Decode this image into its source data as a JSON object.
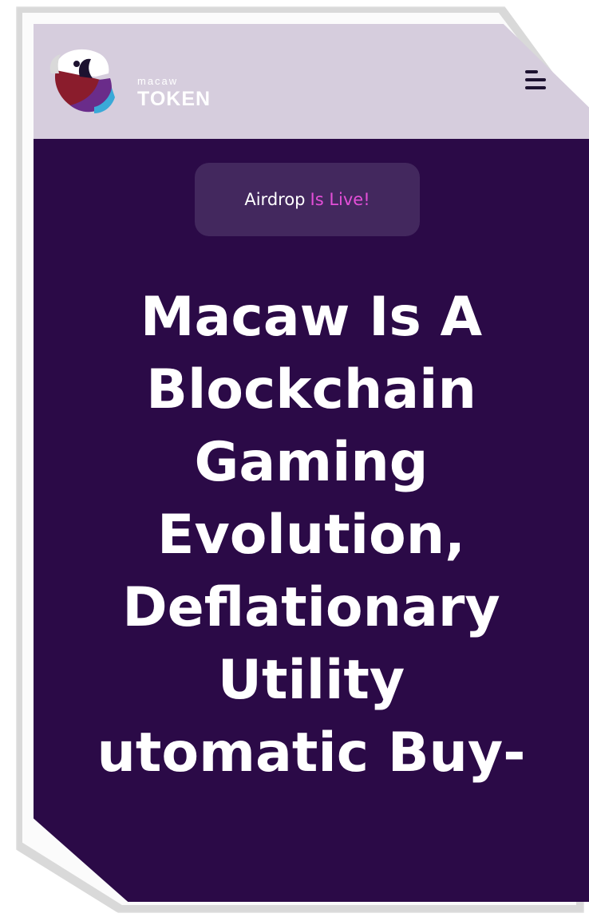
{
  "header": {
    "logo_small": "macaw",
    "logo_big": "TOKEN"
  },
  "hero": {
    "badge_prefix": "Airdrop",
    "badge_highlight": "Is Live!",
    "headline_lines": [
      "Macaw Is A",
      "Blockchain",
      "Gaming",
      "Evolution,",
      "Deflationary",
      "Utility",
      "utomatic Buy-"
    ]
  },
  "colors": {
    "header_bg": "#d6cddd",
    "hero_bg": "#2b0a47",
    "badge_bg": "#43285e",
    "accent_pink": "#e44fd8"
  }
}
